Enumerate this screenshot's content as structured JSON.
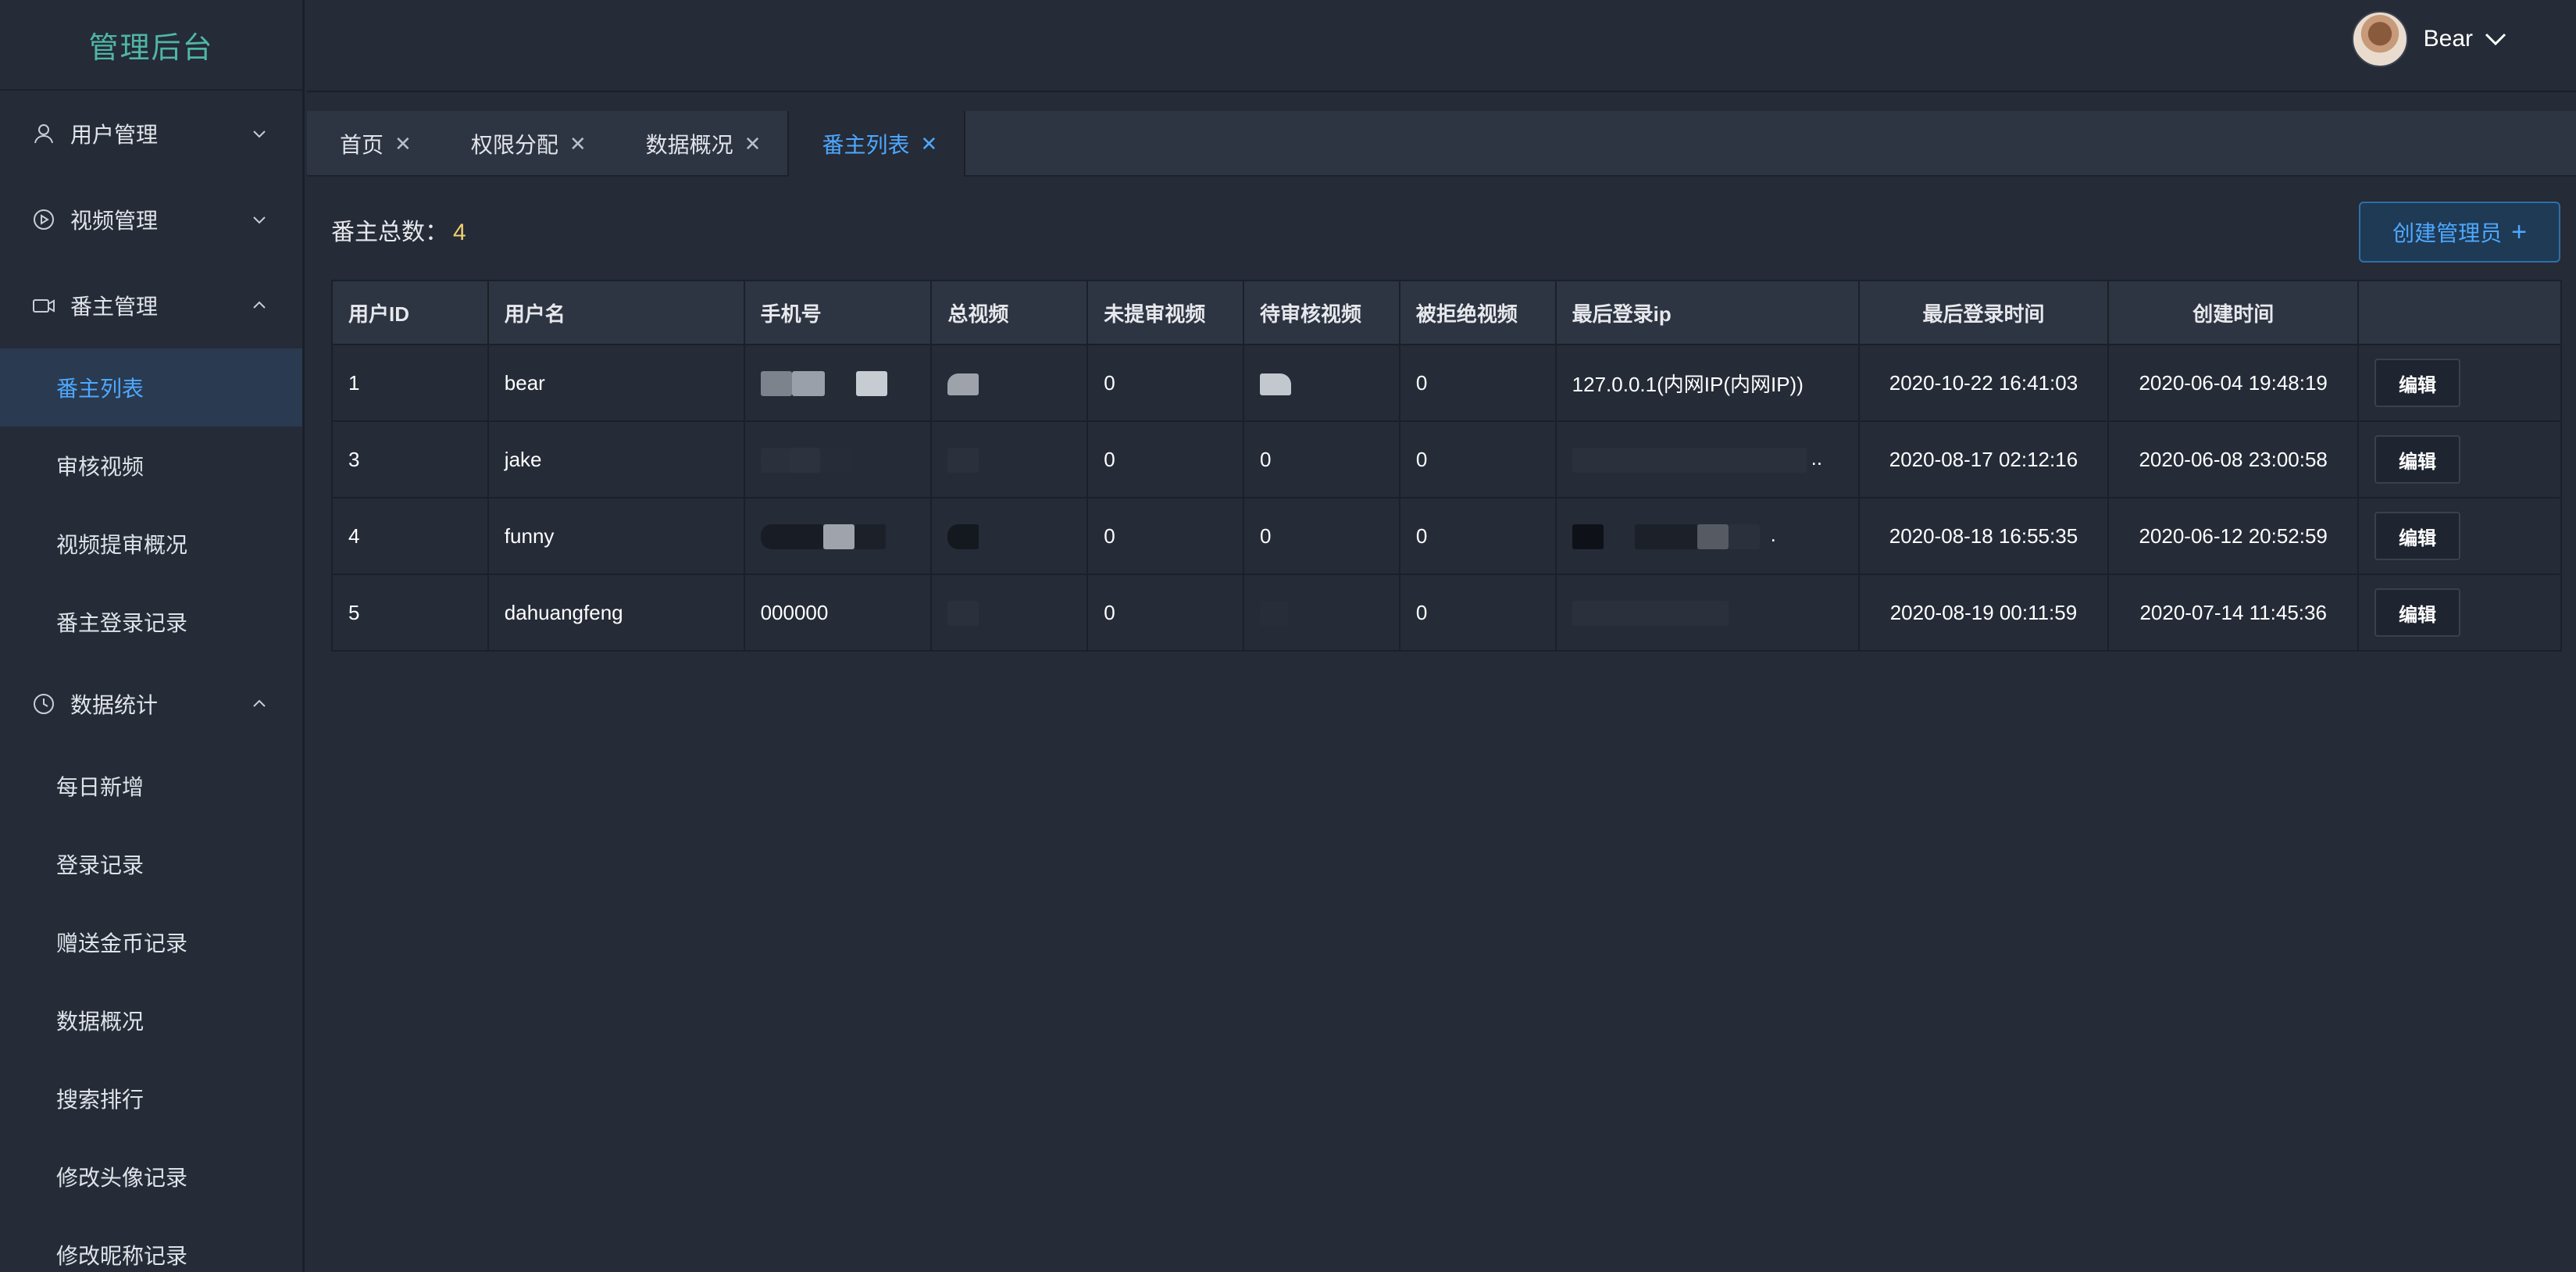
{
  "brand": "管理后台",
  "header": {
    "username": "Bear"
  },
  "sidebar": {
    "groups": [
      {
        "label": "用户管理",
        "icon": "user-icon",
        "expanded": false
      },
      {
        "label": "视频管理",
        "icon": "play-circle-icon",
        "expanded": false
      },
      {
        "label": "番主管理",
        "icon": "video-camera-icon",
        "expanded": true,
        "items": [
          "番主列表",
          "审核视频",
          "视频提审概况",
          "番主登录记录"
        ]
      },
      {
        "label": "数据统计",
        "icon": "clock-icon",
        "expanded": true,
        "items": [
          "每日新增",
          "登录记录",
          "赠送金币记录",
          "数据概况",
          "搜索排行",
          "修改头像记录",
          "修改昵称记录"
        ]
      }
    ],
    "active_item": "番主列表"
  },
  "tabs": [
    {
      "label": "首页",
      "active": false
    },
    {
      "label": "权限分配",
      "active": false
    },
    {
      "label": "数据概况",
      "active": false
    },
    {
      "label": "番主列表",
      "active": true
    }
  ],
  "main": {
    "count_label": "番主总数：",
    "count_value": "4",
    "create_button": "创建管理员",
    "edit_label": "编辑"
  },
  "table": {
    "columns": [
      "用户ID",
      "用户名",
      "手机号",
      "总视频",
      "未提审视频",
      "待审核视频",
      "被拒绝视频",
      "最后登录ip",
      "最后登录时间",
      "创建时间",
      ""
    ],
    "rows": [
      {
        "id": "1",
        "name": "bear",
        "phone": "",
        "total": "",
        "unsubmitted": "0",
        "pending": "",
        "rejected": "0",
        "ip": "127.0.0.1(内网IP(内网IP))",
        "last_login": "2020-10-22 16:41:03",
        "created": "2020-06-04 19:48:19"
      },
      {
        "id": "3",
        "name": "jake",
        "phone": "",
        "total": "",
        "unsubmitted": "0",
        "pending": "0",
        "rejected": "0",
        "ip": "..",
        "last_login": "2020-08-17 02:12:16",
        "created": "2020-06-08 23:00:58"
      },
      {
        "id": "4",
        "name": "funny",
        "phone": "",
        "total": "",
        "unsubmitted": "0",
        "pending": "0",
        "rejected": "0",
        "ip": ".",
        "last_login": "2020-08-18 16:55:35",
        "created": "2020-06-12 20:52:59"
      },
      {
        "id": "5",
        "name": "dahuangfeng",
        "phone": "000000",
        "total": "",
        "unsubmitted": "0",
        "pending": "",
        "rejected": "0",
        "ip": "",
        "last_login": "2020-08-19 00:11:59",
        "created": "2020-07-14 11:45:36"
      }
    ]
  },
  "colors": {
    "accent": "#4ea8ff",
    "brand": "#4fb6a5",
    "count": "#f0d070",
    "bg": "#252b37"
  }
}
